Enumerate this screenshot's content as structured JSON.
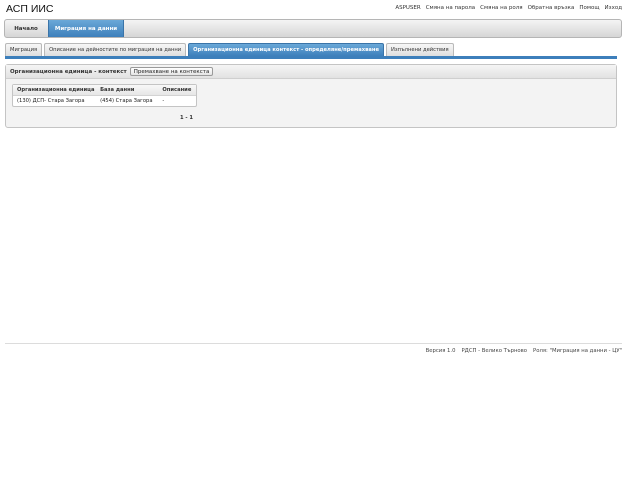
{
  "app": {
    "title": "АСП ИИС"
  },
  "top_links": [
    "ASPUSER",
    "Смяна на парола",
    "Смяна на роля",
    "Обратна връзка",
    "Помощ",
    "Изход"
  ],
  "main_nav": {
    "home": "Начало",
    "migration": "Миграция на данни"
  },
  "sub_tabs": [
    "Миграция",
    "Описание на дейностите по миграция на данни",
    "Организационна единица контекст - определяне/премахване",
    "Изпълнени действия"
  ],
  "active_sub_tab_index": 2,
  "panel": {
    "title": "Организационна единица - контекст",
    "remove_button": "Премахване на контекста"
  },
  "table": {
    "headers": [
      "Организационна единица",
      "База данни",
      "Описание"
    ],
    "rows": [
      [
        "(130) ДСП- Стара Загора",
        "(454) Стара Загора",
        "-"
      ]
    ]
  },
  "pager": "1 - 1",
  "footer": {
    "version": "Версия 1.0",
    "office": "РДСП - Велико Търново",
    "role": "Роля: \"Миграция на данни - ЦУ\""
  },
  "colors": {
    "accent": "#3d7fbb",
    "tab_gradient_top": "#6aa8d8"
  }
}
